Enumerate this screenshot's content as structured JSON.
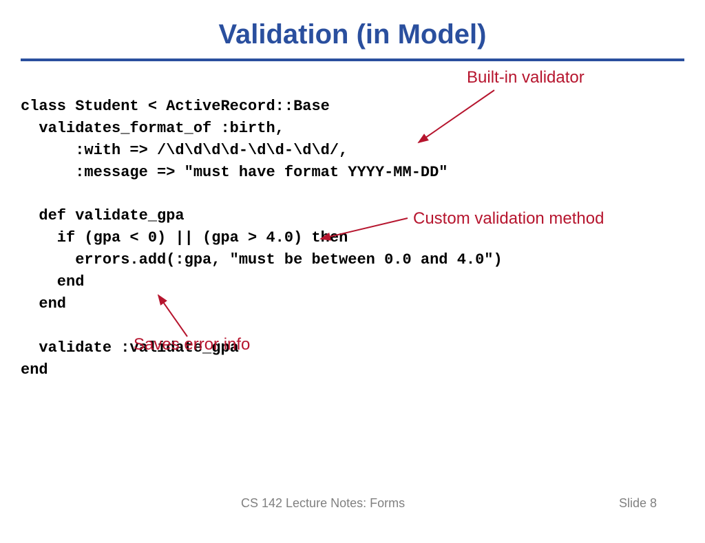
{
  "slide": {
    "title": "Validation (in Model)",
    "code_lines": {
      "l1": "class Student < ActiveRecord::Base",
      "l2": "  validates_format_of :birth,",
      "l3": "      :with => /\\d\\d\\d\\d-\\d\\d-\\d\\d/,",
      "l4": "      :message => \"must have format YYYY-MM-DD\"",
      "l5": "",
      "l6": "  def validate_gpa",
      "l7": "    if (gpa < 0) || (gpa > 4.0) then",
      "l8": "      errors.add(:gpa, \"must be between 0.0 and 4.0\")",
      "l9": "    end",
      "l10": "  end",
      "l11": "",
      "l12": "  validate :validate_gpa",
      "l13": "end"
    },
    "annotations": {
      "builtin": "Built-in validator",
      "custom": "Custom validation method",
      "saves": "Saves error info"
    },
    "footer": {
      "course": "CS 142 Lecture Notes: Forms",
      "slide_label": "Slide 8"
    },
    "colors": {
      "title_color": "#2a4f9e",
      "annotation_color": "#b6152e"
    }
  }
}
